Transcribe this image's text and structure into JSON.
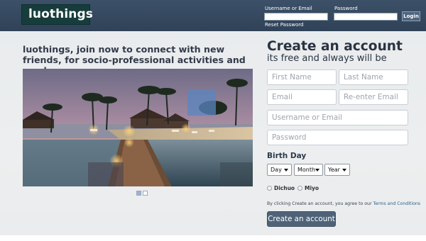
{
  "header": {
    "logo": "luothings",
    "username_label": "Username or Email",
    "password_label": "Password",
    "login_label": "Login",
    "reset_label": "Reset Password",
    "username_value": "",
    "password_value": ""
  },
  "intro": {
    "tagline": "luothings, join now to connect with new friends, for socio-professional activities and much more."
  },
  "slider": {
    "dots": [
      {
        "active": true
      },
      {
        "active": false
      }
    ]
  },
  "signup": {
    "title": "Create an account",
    "subtitle": "its free and always will be",
    "first_name": "First Name",
    "last_name": "Last Name",
    "email": "Email",
    "reenter_email": "Re-enter Email",
    "username": "Username or Email",
    "password": "Password",
    "birthday_label": "Birth Day",
    "day_select": "Day",
    "month_select": "Month",
    "year_select": "Year",
    "gender_options": [
      "Dichuo",
      "Miyo"
    ],
    "terms_prefix": "By clicking Create an account, you agree to our ",
    "terms_link": "Terms and Conditions",
    "submit": "Create an account"
  },
  "colors": {
    "header_bg": "#364a61",
    "logo_bg": "#163d3c",
    "button_bg": "#4f6378",
    "page_bg": "#eaeced"
  }
}
